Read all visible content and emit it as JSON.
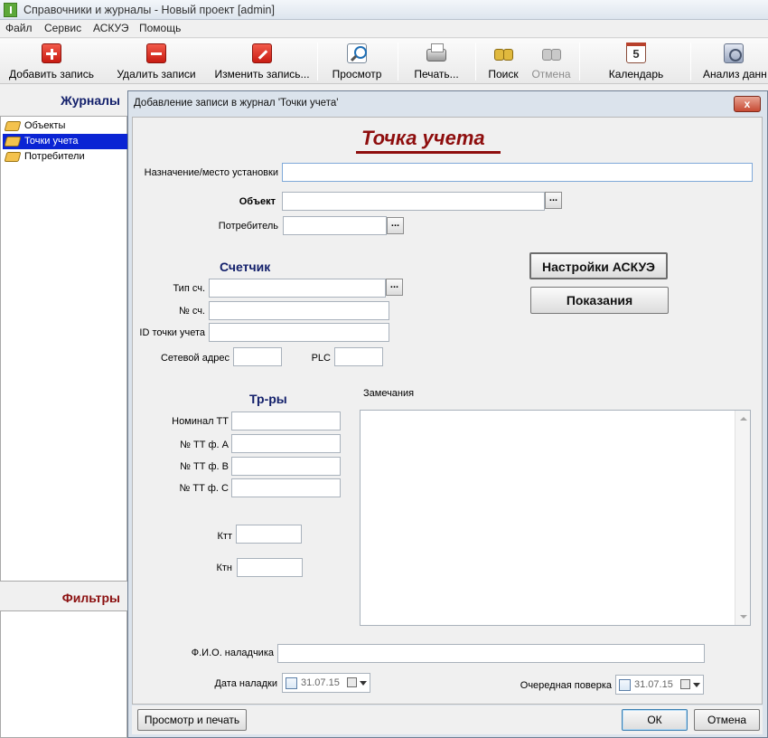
{
  "window": {
    "title": "Справочники и журналы - Новый проект  [admin]"
  },
  "menu": [
    "Файл",
    "Сервис",
    "АСКУЭ",
    "Помощь"
  ],
  "toolbar": {
    "add": "Добавить запись",
    "delete": "Удалить записи",
    "edit": "Изменить запись...",
    "view": "Просмотр",
    "print": "Печать...",
    "search": "Поиск",
    "cancel": "Отмена",
    "calendar": "Календарь",
    "analysis": "Анализ данн"
  },
  "sidebar": {
    "journals_title": "Журналы",
    "items": [
      {
        "label": "Объекты"
      },
      {
        "label": "Точки учета"
      },
      {
        "label": "Потребители"
      }
    ],
    "filters_title": "Фильтры"
  },
  "dialog": {
    "title": "Добавление записи в журнал 'Точки учета'",
    "close_label": "x",
    "heading": "Точка учета",
    "purpose_label": "Назначение/место установки",
    "purpose_value": "",
    "object_label": "Объект",
    "object_value": "",
    "consumer_label": "Потребитель",
    "consumer_value": "",
    "browse_label": "...",
    "meter_section": "Счетчик",
    "meter_type_label": "Тип сч.",
    "meter_type_value": "",
    "meter_no_label": "№ сч.",
    "meter_no_value": "",
    "point_id_label": "ID точки учета",
    "point_id_value": "",
    "net_address_label": "Сетевой адрес",
    "net_address_value": "",
    "plc_label": "PLC",
    "plc_value": "",
    "askue_settings_button": "Настройки АСКУЭ",
    "readings_button": "Показания",
    "transformers_section": "Тр-ры",
    "ct_nominal_label": "Номинал ТТ",
    "ct_a_label": "№ ТТ ф. А",
    "ct_b_label": "№ ТТ ф. В",
    "ct_c_label": "№ ТТ ф. С",
    "ktt_label": "Ктт",
    "ktn_label": "Ктн",
    "remarks_label": "Замечания",
    "technician_label": "Ф.И.О. наладчика",
    "technician_value": "",
    "setup_date_label": "Дата наладки",
    "setup_date_value": "31.07.15",
    "next_check_label": "Очередная поверка",
    "next_check_value": "31.07.15",
    "preview_print_button": "Просмотр и печать",
    "ok_button": "ОК",
    "cancel_button": "Отмена"
  },
  "colors": {
    "heading": "#8e0e0e",
    "section": "#13206b",
    "selection": "#0a24d4",
    "filters_title": "#8b1010"
  }
}
